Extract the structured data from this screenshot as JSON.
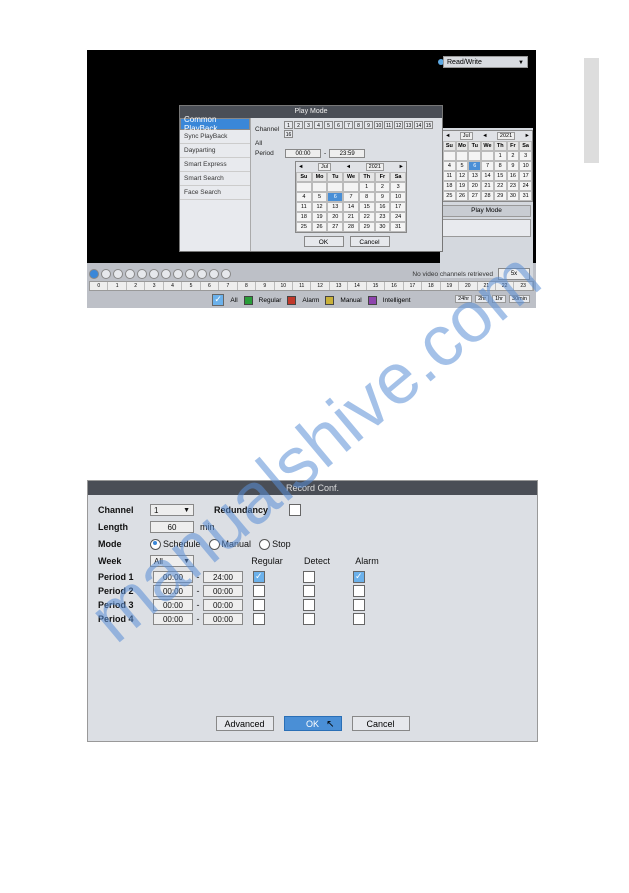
{
  "shot1": {
    "rw_label": "Read/Write",
    "modal": {
      "title": "Play Mode",
      "sidebar": [
        "Common PlayBack",
        "Sync PlayBack",
        "Dayparting",
        "Smart Express",
        "Smart Search",
        "Face Search"
      ],
      "channel_label": "Channel",
      "channels": [
        "1",
        "2",
        "3",
        "4",
        "5",
        "6",
        "7",
        "8",
        "9",
        "10",
        "11",
        "12",
        "13",
        "14",
        "15",
        "16"
      ],
      "all_label": "All",
      "period_label": "Period",
      "period_from": "00:00",
      "period_to": "23:59",
      "cal_month": "Jul",
      "cal_year": "2021",
      "cal_dow": [
        "Su",
        "Mo",
        "Tu",
        "We",
        "Th",
        "Fr",
        "Sa"
      ],
      "cal_days": [
        "",
        "",
        "",
        "",
        "1",
        "2",
        "3",
        "4",
        "5",
        "6",
        "7",
        "8",
        "9",
        "10",
        "11",
        "12",
        "13",
        "14",
        "15",
        "16",
        "17",
        "18",
        "19",
        "20",
        "21",
        "22",
        "23",
        "24",
        "25",
        "26",
        "27",
        "28",
        "29",
        "30",
        "31"
      ],
      "ok": "OK",
      "cancel": "Cancel"
    },
    "rpanel": {
      "cal_month": "Jul",
      "cal_year": "2021",
      "cal_dow": [
        "Su",
        "Mo",
        "Tu",
        "We",
        "Th",
        "Fr",
        "Sa"
      ],
      "play_mode": "Play Mode"
    },
    "novid": "No video channels retrieved",
    "speed": "5x",
    "timeline": [
      "0",
      "1",
      "2",
      "3",
      "4",
      "5",
      "6",
      "7",
      "8",
      "9",
      "10",
      "11",
      "12",
      "13",
      "14",
      "15",
      "16",
      "17",
      "18",
      "19",
      "20",
      "21",
      "22",
      "23"
    ],
    "legend": {
      "all": "All",
      "regular": "Regular",
      "alarm": "Alarm",
      "manual": "Manual",
      "intelligent": "Intelligent"
    },
    "zoom": [
      "24hr",
      "2hr",
      "1hr",
      "30min"
    ]
  },
  "shot2": {
    "title": "Record Conf.",
    "labels": {
      "channel": "Channel",
      "length": "Length",
      "mode": "Mode",
      "week": "Week",
      "redundancy": "Redundancy",
      "min": "min"
    },
    "channel_value": "1",
    "length_value": "60",
    "mode": {
      "schedule": "Schedule",
      "manual": "Manual",
      "stop": "Stop"
    },
    "week_value": "All",
    "headers": {
      "regular": "Regular",
      "detect": "Detect",
      "alarm": "Alarm"
    },
    "periods": [
      {
        "label": "Period 1",
        "from": "00:00",
        "to": "24:00",
        "reg": true,
        "det": false,
        "alm": true
      },
      {
        "label": "Period 2",
        "from": "00:00",
        "to": "00:00",
        "reg": false,
        "det": false,
        "alm": false
      },
      {
        "label": "Period 3",
        "from": "00:00",
        "to": "00:00",
        "reg": false,
        "det": false,
        "alm": false
      },
      {
        "label": "Period 4",
        "from": "00:00",
        "to": "00:00",
        "reg": false,
        "det": false,
        "alm": false
      }
    ],
    "buttons": {
      "advanced": "Advanced",
      "ok": "OK",
      "cancel": "Cancel"
    }
  },
  "watermark": "manualshive.com"
}
